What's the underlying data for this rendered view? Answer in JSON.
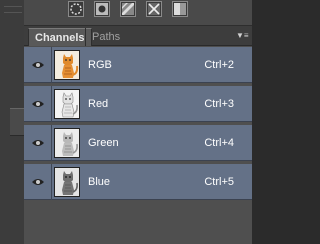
{
  "panel": {
    "tabs": [
      {
        "label": "Channels",
        "active": true
      },
      {
        "label": "Paths",
        "active": false
      }
    ],
    "menu_icon": "panel-menu-icon"
  },
  "toolbar": {
    "icons": [
      "dotted-circle-icon",
      "save-selection-icon",
      "new-channel-icon",
      "delete-channel-icon",
      "channel-options-icon"
    ]
  },
  "channels": [
    {
      "name": "RGB",
      "shortcut": "Ctrl+2",
      "thumb": "color"
    },
    {
      "name": "Red",
      "shortcut": "Ctrl+3",
      "thumb": "red"
    },
    {
      "name": "Green",
      "shortcut": "Ctrl+4",
      "thumb": "green"
    },
    {
      "name": "Blue",
      "shortcut": "Ctrl+5",
      "thumb": "blue"
    }
  ],
  "colors": {
    "selected_row": "#647187",
    "panel_bg": "#4e4e4e",
    "text": "#ffffff"
  }
}
